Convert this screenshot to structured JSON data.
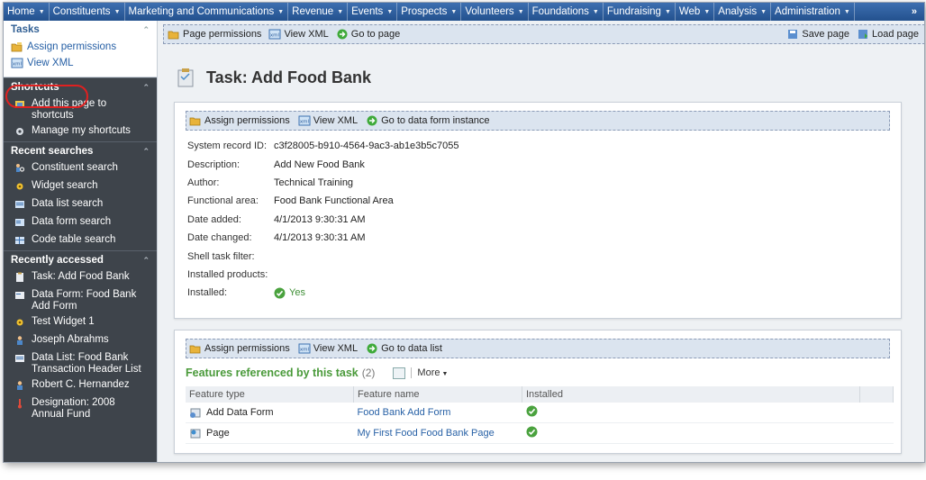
{
  "topnav": {
    "items": [
      "Home",
      "Constituents",
      "Marketing and Communications",
      "Revenue",
      "Events",
      "Prospects",
      "Volunteers",
      "Foundations",
      "Fundraising",
      "Web",
      "Analysis",
      "Administration"
    ],
    "more": "»"
  },
  "sidebar": {
    "tasks": {
      "title": "Tasks",
      "items": [
        "Assign permissions",
        "View XML"
      ]
    },
    "shortcuts": {
      "title": "Shortcuts",
      "items": [
        "Add this page to shortcuts",
        "Manage my shortcuts"
      ]
    },
    "recent_searches": {
      "title": "Recent searches",
      "items": [
        "Constituent search",
        "Widget search",
        "Data list search",
        "Data form search",
        "Code table search"
      ]
    },
    "recently_accessed": {
      "title": "Recently accessed",
      "items": [
        "Task: Add Food Bank",
        "Data Form: Food Bank Add Form",
        "Test Widget 1",
        "Joseph Abrahms",
        "Data List: Food Bank Transaction Header List",
        "Robert C. Hernandez",
        "Designation: 2008 Annual Fund"
      ]
    }
  },
  "toolbar": {
    "page_permissions": "Page permissions",
    "view_xml": "View XML",
    "go_to_page": "Go to page",
    "save_page": "Save page",
    "load_page": "Load page"
  },
  "page": {
    "title": "Task: Add Food Bank"
  },
  "details": {
    "toolbar": {
      "assign_permissions": "Assign permissions",
      "view_xml": "View XML",
      "go_to": "Go to data form instance"
    },
    "fields": [
      {
        "label": "System record ID:",
        "value": "c3f28005-b910-4564-9ac3-ab1e3b5c7055"
      },
      {
        "label": "Description:",
        "value": "Add New Food Bank"
      },
      {
        "label": "Author:",
        "value": "Technical Training"
      },
      {
        "label": "Functional area:",
        "value": "Food Bank Functional Area"
      },
      {
        "label": "Date added:",
        "value": "4/1/2013 9:30:31 AM"
      },
      {
        "label": "Date changed:",
        "value": "4/1/2013 9:30:31 AM"
      },
      {
        "label": "Shell task filter:",
        "value": ""
      },
      {
        "label": "Installed products:",
        "value": ""
      },
      {
        "label": "Installed:",
        "value": "Yes"
      }
    ]
  },
  "features": {
    "toolbar": {
      "assign_permissions": "Assign permissions",
      "view_xml": "View XML",
      "go_to": "Go to data list"
    },
    "title": "Features referenced by this task",
    "count": "(2)",
    "more": "More",
    "columns": [
      "Feature type",
      "Feature name",
      "Installed"
    ],
    "rows": [
      {
        "type": "Add Data Form",
        "name": "Food Bank Add Form"
      },
      {
        "type": "Page",
        "name": "My First Food Food Bank Page"
      }
    ]
  },
  "colors": {
    "nav": "#2b5c9c",
    "sidebar": "#3e444b",
    "link": "#2861a6",
    "section_title": "#4a9a3a",
    "highlight": "#e02020"
  }
}
